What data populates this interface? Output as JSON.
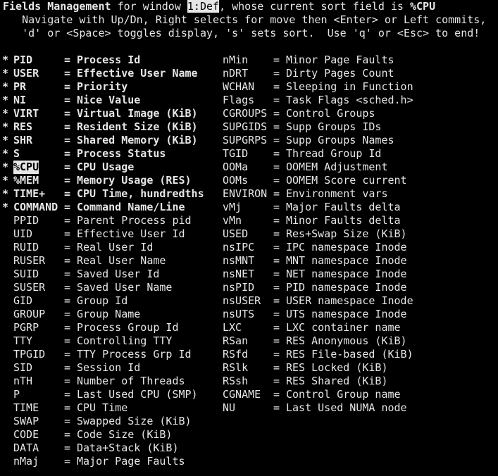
{
  "header": {
    "title": "Fields Management",
    "for_window_text": "for window",
    "window": "1:Def",
    "sort_text": ", whose current sort field is",
    "sort_field": "%CPU",
    "help_line_1": "   Navigate with Up/Dn, Right selects for move then <Enter> or Left commits,",
    "help_line_2": "   'd' or <Space> toggles display, 's' sets sort.  Use 'q' or <Esc> to end!"
  },
  "equals": "=",
  "active_mark": "*",
  "left_fields": [
    {
      "name": "PID",
      "desc": "Process Id",
      "active": true
    },
    {
      "name": "USER",
      "desc": "Effective User Name",
      "active": true
    },
    {
      "name": "PR",
      "desc": "Priority",
      "active": true
    },
    {
      "name": "NI",
      "desc": "Nice Value",
      "active": true
    },
    {
      "name": "VIRT",
      "desc": "Virtual Image (KiB)",
      "active": true
    },
    {
      "name": "RES",
      "desc": "Resident Size (KiB)",
      "active": true
    },
    {
      "name": "SHR",
      "desc": "Shared Memory (KiB)",
      "active": true
    },
    {
      "name": "S",
      "desc": "Process Status",
      "active": true
    },
    {
      "name": "%CPU",
      "desc": "CPU Usage",
      "active": true,
      "selected": true
    },
    {
      "name": "%MEM",
      "desc": "Memory Usage (RES)",
      "active": true
    },
    {
      "name": "TIME+",
      "desc": "CPU Time, hundredths",
      "active": true
    },
    {
      "name": "COMMAND",
      "desc": "Command Name/Line",
      "active": true
    },
    {
      "name": "PPID",
      "desc": "Parent Process pid",
      "active": false
    },
    {
      "name": "UID",
      "desc": "Effective User Id",
      "active": false
    },
    {
      "name": "RUID",
      "desc": "Real User Id",
      "active": false
    },
    {
      "name": "RUSER",
      "desc": "Real User Name",
      "active": false
    },
    {
      "name": "SUID",
      "desc": "Saved User Id",
      "active": false
    },
    {
      "name": "SUSER",
      "desc": "Saved User Name",
      "active": false
    },
    {
      "name": "GID",
      "desc": "Group Id",
      "active": false
    },
    {
      "name": "GROUP",
      "desc": "Group Name",
      "active": false
    },
    {
      "name": "PGRP",
      "desc": "Process Group Id",
      "active": false
    },
    {
      "name": "TTY",
      "desc": "Controlling TTY",
      "active": false
    },
    {
      "name": "TPGID",
      "desc": "TTY Process Grp Id",
      "active": false
    },
    {
      "name": "SID",
      "desc": "Session Id",
      "active": false
    },
    {
      "name": "nTH",
      "desc": "Number of Threads",
      "active": false
    },
    {
      "name": "P",
      "desc": "Last Used CPU (SMP)",
      "active": false
    },
    {
      "name": "TIME",
      "desc": "CPU Time",
      "active": false
    },
    {
      "name": "SWAP",
      "desc": "Swapped Size (KiB)",
      "active": false
    },
    {
      "name": "CODE",
      "desc": "Code Size (KiB)",
      "active": false
    },
    {
      "name": "DATA",
      "desc": "Data+Stack (KiB)",
      "active": false
    },
    {
      "name": "nMaj",
      "desc": "Major Page Faults",
      "active": false
    }
  ],
  "right_fields": [
    {
      "name": "nMin",
      "desc": "Minor Page Faults"
    },
    {
      "name": "nDRT",
      "desc": "Dirty Pages Count"
    },
    {
      "name": "WCHAN",
      "desc": "Sleeping in Function"
    },
    {
      "name": "Flags",
      "desc": "Task Flags <sched.h>"
    },
    {
      "name": "CGROUPS",
      "desc": "Control Groups"
    },
    {
      "name": "SUPGIDS",
      "desc": "Supp Groups IDs"
    },
    {
      "name": "SUPGRPS",
      "desc": "Supp Groups Names"
    },
    {
      "name": "TGID",
      "desc": "Thread Group Id"
    },
    {
      "name": "OOMa",
      "desc": "OOMEM Adjustment"
    },
    {
      "name": "OOMs",
      "desc": "OOMEM Score current"
    },
    {
      "name": "ENVIRON",
      "desc": "Environment vars"
    },
    {
      "name": "vMj",
      "desc": "Major Faults delta"
    },
    {
      "name": "vMn",
      "desc": "Minor Faults delta"
    },
    {
      "name": "USED",
      "desc": "Res+Swap Size (KiB)"
    },
    {
      "name": "nsIPC",
      "desc": "IPC namespace Inode"
    },
    {
      "name": "nsMNT",
      "desc": "MNT namespace Inode"
    },
    {
      "name": "nsNET",
      "desc": "NET namespace Inode"
    },
    {
      "name": "nsPID",
      "desc": "PID namespace Inode"
    },
    {
      "name": "nsUSER",
      "desc": "USER namespace Inode"
    },
    {
      "name": "nsUTS",
      "desc": "UTS namespace Inode"
    },
    {
      "name": "LXC",
      "desc": "LXC container name"
    },
    {
      "name": "RSan",
      "desc": "RES Anonymous (KiB)"
    },
    {
      "name": "RSfd",
      "desc": "RES File-based (KiB)"
    },
    {
      "name": "RSlk",
      "desc": "RES Locked (KiB)"
    },
    {
      "name": "RSsh",
      "desc": "RES Shared (KiB)"
    },
    {
      "name": "CGNAME",
      "desc": "Control Group name"
    },
    {
      "name": "NU",
      "desc": "Last Used NUMA node"
    }
  ]
}
